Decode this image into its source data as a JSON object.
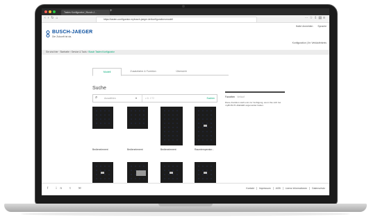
{
  "browser": {
    "tab_title": "Tastes Konfigurator | Busch-J...",
    "url": "https://tasten-configurator.mybusch-jaeger.de/konfigurationsmodell"
  },
  "header": {
    "logo_text": "BUSCH-JAEGER",
    "logo_sub": "Die Zukunft ist da.",
    "meta": [
      "Hallo! Anmelden",
      "Sprache"
    ],
    "links": [
      "Konfiguration",
      "Ihr Verkäuferkreis"
    ]
  },
  "breadcrumb": {
    "items": [
      "Sie sind hier",
      "Startseite",
      "Service & Tools"
    ],
    "active": "Busch Tasten Konfigurator"
  },
  "tabs": [
    "Modell",
    "Zusatzfarbe & Funktion",
    "Übersicht"
  ],
  "section_title": "Suche",
  "search": {
    "select_placeholder": "Auswählen",
    "input_placeholder": "z.B. CT2",
    "button": "Suchen"
  },
  "info": {
    "title": "Favoriten",
    "muted": "Verlauf",
    "text": "Diese Funktion steht erst zur Verfügung, wenn Sie sich bei myBUSCH-JAEGER angemeldet haben."
  },
  "products": [
    {
      "label": "Bedienelement"
    },
    {
      "label": "Bedienelement"
    },
    {
      "label": "Bedienelement"
    },
    {
      "label": "Raumtemperatur..."
    }
  ],
  "footer": {
    "social": [
      "f",
      "in",
      "t",
      "✉"
    ],
    "links": [
      "Kontakt",
      "Impressum",
      "AGB",
      "Lizenz Informationen",
      "Datenschutz"
    ]
  },
  "colors": {
    "brand": "#0a4f9f",
    "accent": "#00aa77"
  }
}
